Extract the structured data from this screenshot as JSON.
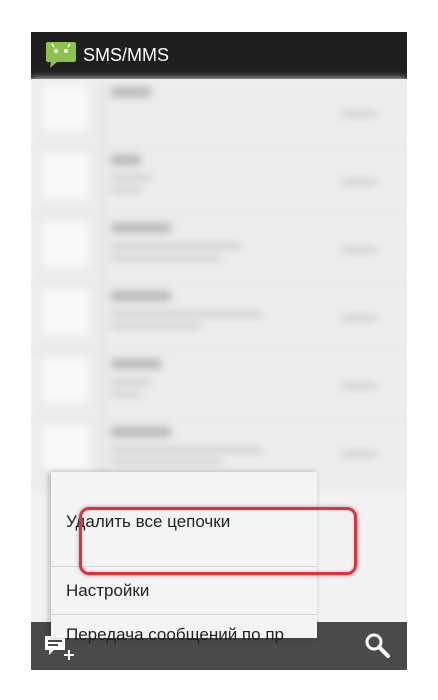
{
  "app": {
    "title": "SMS/MMS",
    "icon": "android-messaging-icon",
    "accent": "#8bc34a"
  },
  "menu": {
    "items": [
      {
        "label": "Удалить все цепочки"
      },
      {
        "label": "Настройки"
      },
      {
        "label": "Передача сообщений по пр"
      }
    ]
  },
  "bottom_bar": {
    "compose_icon": "new-message-icon",
    "search_icon": "search-icon"
  },
  "highlight_color": "#e53038"
}
